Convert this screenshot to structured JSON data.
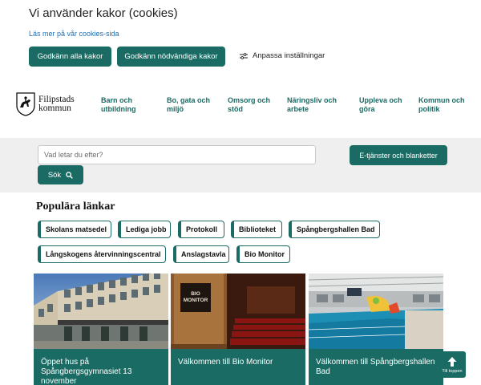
{
  "cookie": {
    "title": "Vi använder kakor (cookies)",
    "read_more": "Läs mer på vår cookies-sida",
    "accept_all": "Godkänn alla kakor",
    "accept_needed": "Godkänn nödvändiga kakor",
    "customize": "Anpassa inställningar"
  },
  "header": {
    "logo_line1": "Filipstads",
    "logo_line2": "kommun",
    "nav": [
      {
        "label": "Barn och utbildning"
      },
      {
        "label": "Bo, gata och miljö"
      },
      {
        "label": "Omsorg och stöd"
      },
      {
        "label": "Näringsliv och arbete"
      },
      {
        "label": "Uppleva och göra"
      },
      {
        "label": "Kommun och politik"
      }
    ]
  },
  "search": {
    "placeholder": "Vad letar du efter?",
    "button": "Sök",
    "eservices": "E-tjänster och blanketter"
  },
  "popular": {
    "title": "Populära länkar",
    "links": [
      "Skolans matsedel",
      "Lediga jobb",
      "Protokoll",
      "Biblioteket",
      "Spångbergshallen Bad",
      "Långskogens återvinningscentral",
      "Anslagstavla",
      "Bio Monitor"
    ]
  },
  "cards": [
    {
      "title": "Öppet hus på Spångbergsgymnasiet 13 november"
    },
    {
      "title": "Välkommen till Bio Monitor",
      "sign_line1": "BIO",
      "sign_line2": "MONITOR"
    },
    {
      "title": "Välkommen till Spångbergshallen Bad"
    }
  ],
  "to_top": "Till toppen",
  "colors": {
    "accent": "#1a6b63",
    "link": "#1f6fb5",
    "band": "#efefef"
  }
}
